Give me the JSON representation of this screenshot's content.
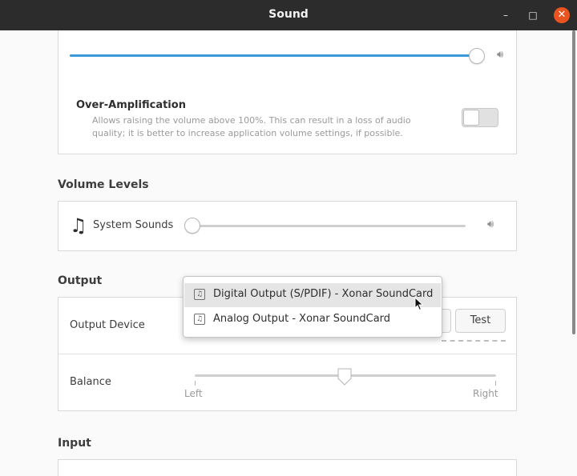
{
  "window": {
    "title": "Sound",
    "minimize_glyph": "–",
    "maximize_glyph": "□",
    "close_glyph": "✕"
  },
  "output_volume": {
    "level_percent": 100,
    "speaker_icon": "speaker-high-icon"
  },
  "over_amplification": {
    "title": "Over-Amplification",
    "description": "Allows raising the volume above 100%. This can result in a loss of audio quality; it is better to increase application volume settings, if possible.",
    "enabled": false
  },
  "volume_levels": {
    "heading": "Volume Levels",
    "system_sounds": {
      "label": "System Sounds",
      "icon": "music-note-icon",
      "level_percent": 0
    }
  },
  "output": {
    "heading": "Output",
    "device_label": "Output Device",
    "test_label": "Test",
    "balance_label": "Balance",
    "balance_left": "Left",
    "balance_right": "Right",
    "balance_value": 0.5,
    "device_options": [
      {
        "label": "Digital Output (S/PDIF) - Xonar SoundCard",
        "highlighted": true
      },
      {
        "label": "Analog Output - Xonar SoundCard",
        "highlighted": false
      }
    ]
  },
  "input": {
    "heading": "Input"
  },
  "colors": {
    "accent": "#3a9ad9",
    "titlebar": "#2c2c2c",
    "close_button": "#e95420"
  }
}
